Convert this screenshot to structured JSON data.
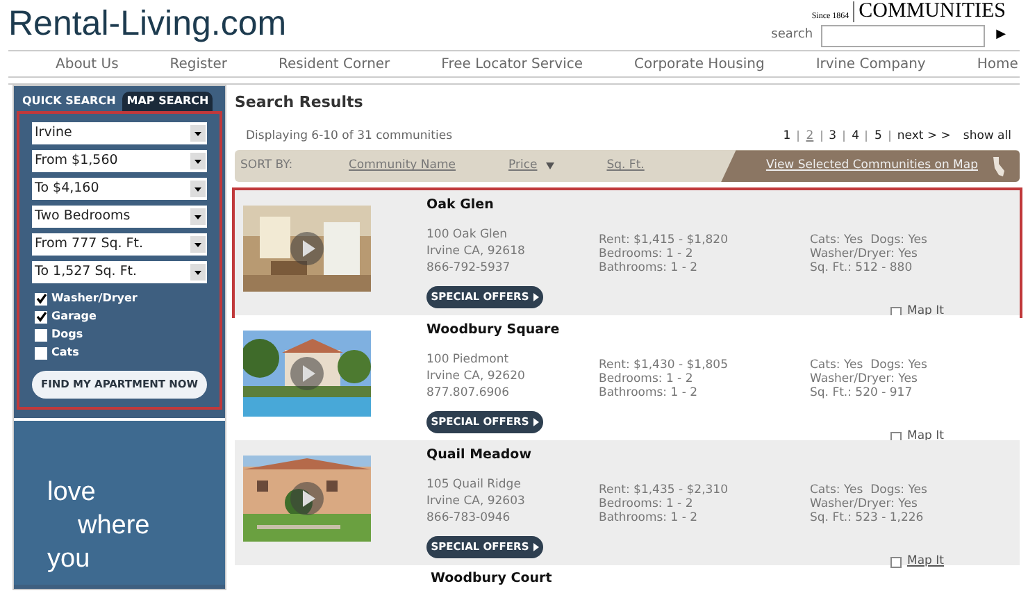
{
  "logo": "Rental-Living.com",
  "brand": {
    "tagline": "Since 1864",
    "name": "COMMUNITIES"
  },
  "search": {
    "label": "search",
    "button": "▶"
  },
  "nav": [
    "About Us",
    "Register",
    "Resident Corner",
    "Free Locator Service",
    "Corporate Housing",
    "Irvine Company",
    "Home"
  ],
  "sidebar": {
    "tabs": [
      {
        "label": "QUICK SEARCH",
        "selected": true
      },
      {
        "label": "MAP SEARCH",
        "selected": false
      }
    ],
    "selects": [
      "Irvine",
      "From $1,560",
      "To $4,160",
      "Two Bedrooms",
      "From 777 Sq. Ft.",
      "To 1,527 Sq. Ft."
    ],
    "checkboxes": [
      {
        "label": "Washer/Dryer",
        "checked": true
      },
      {
        "label": "Garage",
        "checked": true
      },
      {
        "label": "Dogs",
        "checked": false
      },
      {
        "label": "Cats",
        "checked": false
      }
    ],
    "button": "FIND MY APARTMENT NOW",
    "banner": [
      "love",
      "where",
      "you"
    ]
  },
  "results": {
    "title": "Search Results",
    "summary": "Displaying 6-10 of 31 communities",
    "pages": [
      {
        "label": "1",
        "selected": false
      },
      {
        "label": "2",
        "selected": true
      },
      {
        "label": "3",
        "selected": false
      },
      {
        "label": "4",
        "selected": false
      },
      {
        "label": "5",
        "selected": false
      }
    ],
    "next": "next > >",
    "show_all": "show all",
    "sort_label": "SORT BY:",
    "sort": [
      {
        "label": "Community Name",
        "selected": false
      },
      {
        "label": "Price",
        "selected": true
      },
      {
        "label": "Sq. Ft.",
        "selected": false
      }
    ],
    "map_link": "View Selected Communities on Map",
    "listings": [
      {
        "name": "Oak Glen",
        "highlighted": true,
        "address": [
          "100 Oak Glen",
          "Irvine CA, 92618",
          "866-792-5937"
        ],
        "details": [
          "Rent: $1,415 - $1,820",
          "Bedrooms: 1 - 2",
          "Bathrooms: 1 - 2"
        ],
        "features": [
          "Cats: Yes  Dogs: Yes",
          "Washer/Dryer: Yes",
          "Sq. Ft.: 512 - 880"
        ],
        "offers": "SPECIAL OFFERS",
        "map_it": "Map It",
        "map_checked": false
      },
      {
        "name": "Woodbury Square",
        "highlighted": false,
        "address": [
          "100 Piedmont",
          "Irvine CA, 92620",
          "877.807.6906"
        ],
        "details": [
          "Rent: $1,430 - $1,805",
          "Bedrooms: 1 - 2",
          "Bathrooms: 1 - 2"
        ],
        "features": [
          "Cats: Yes  Dogs: Yes",
          "Washer/Dryer: Yes",
          "Sq. Ft.: 520 - 917"
        ],
        "offers": "SPECIAL OFFERS",
        "map_it": "Map It",
        "map_checked": false
      },
      {
        "name": "Quail Meadow",
        "highlighted": false,
        "address": [
          "105 Quail Ridge",
          "Irvine CA, 92603",
          "866-783-0946"
        ],
        "details": [
          "Rent: $1,435 - $2,310",
          "Bedrooms: 1 - 2",
          "Bathrooms: 1 - 2"
        ],
        "features": [
          "Cats: Yes  Dogs: Yes",
          "Washer/Dryer: Yes",
          "Sq. Ft.: 523 - 1,226"
        ],
        "offers": "SPECIAL OFFERS",
        "map_it": "Map It",
        "map_checked": false
      }
    ],
    "next_listing": "Woodbury Court"
  }
}
